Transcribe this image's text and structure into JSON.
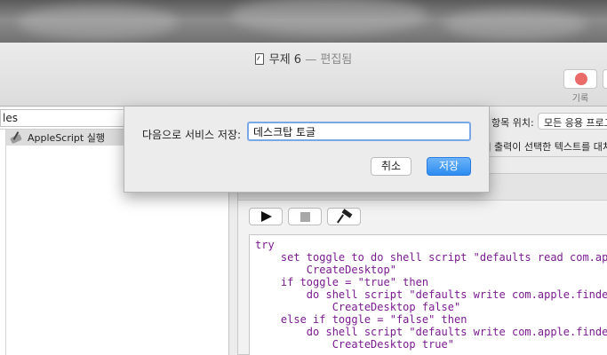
{
  "window": {
    "title": "무제 6",
    "title_sep": "—",
    "title_state": "편집됨",
    "record_label": "기록"
  },
  "library": {
    "search_value": "les",
    "selected_action": "AppleScript 실행"
  },
  "service_bar": {
    "item_position_label": "항목 위치:",
    "item_position_value": "모든 응용 프로그램",
    "replace_label": "출력이 선택한 텍스트를 대치함"
  },
  "script": {
    "lines": [
      "try",
      "    set toggle to do shell script \"defaults read com.apple.finder",
      "        CreateDesktop\"",
      "    if toggle = \"true\" then",
      "        do shell script \"defaults write com.apple.finder",
      "            CreateDesktop false\"",
      "    else if toggle = \"false\" then",
      "        do shell script \"defaults write com.apple.finder",
      "            CreateDesktop true\""
    ]
  },
  "dialog": {
    "label": "다음으로 서비스 저장:",
    "name_value": "데스크탑 토글",
    "cancel_label": "취소",
    "save_label": "저장"
  },
  "colors": {
    "save_button": "#2d8cf0",
    "record_dot": "#ea6a6a",
    "code_text": "#7a1b8f"
  }
}
